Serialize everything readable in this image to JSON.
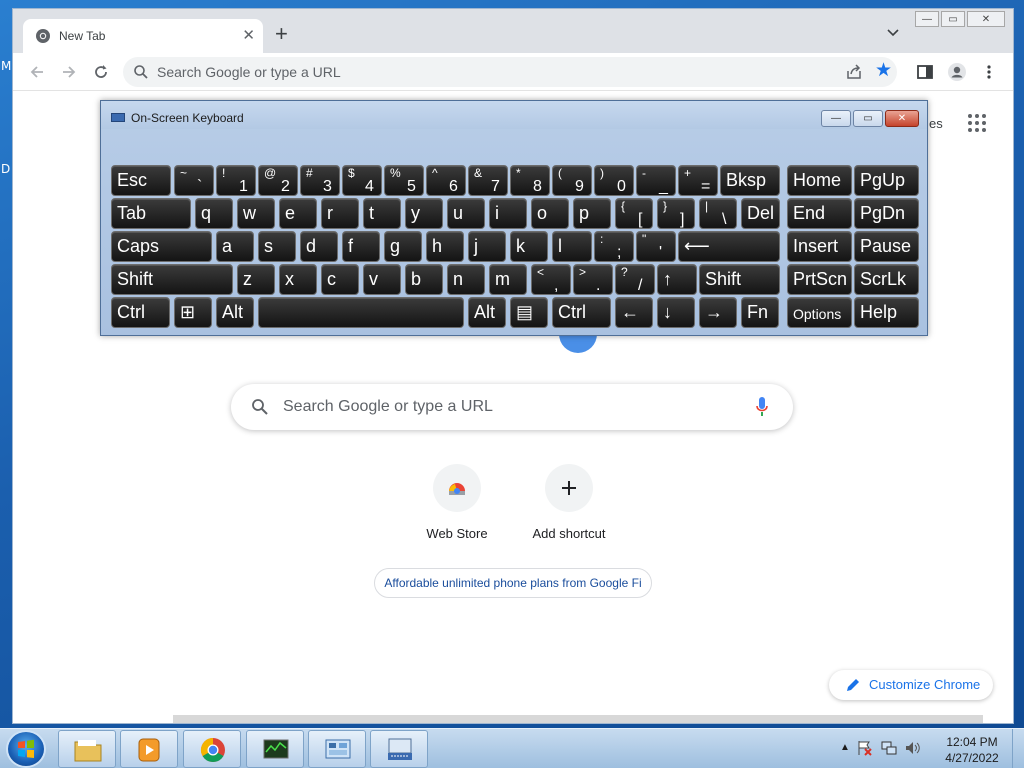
{
  "desktop": {
    "frag_a": "M",
    "frag_b": "D"
  },
  "browser": {
    "tab": {
      "title": "New Tab",
      "close": "✕"
    },
    "new_tab": "+",
    "omnibox": {
      "placeholder": "Search Google or type a URL"
    },
    "window_controls": {
      "minimize": "—",
      "maximize": "▭",
      "close": "✕"
    }
  },
  "ntp": {
    "apps_partial": "es",
    "search_placeholder": "Search Google or type a URL",
    "shortcuts": [
      {
        "label": "Web Store"
      },
      {
        "label": "Add shortcut"
      }
    ],
    "promo": "Affordable unlimited phone plans from Google Fi",
    "customize": "Customize Chrome"
  },
  "osk": {
    "title": "On-Screen Keyboard",
    "controls": {
      "minimize": "—",
      "restore": "▭",
      "close": "✕"
    },
    "rows": [
      [
        {
          "name": "esc",
          "label": "Esc"
        },
        {
          "name": "tilde",
          "shift": "~",
          "low": "`"
        },
        {
          "name": "1",
          "shift": "!",
          "low": "1"
        },
        {
          "name": "2",
          "shift": "@",
          "low": "2"
        },
        {
          "name": "3",
          "shift": "#",
          "low": "3"
        },
        {
          "name": "4",
          "shift": "$",
          "low": "4"
        },
        {
          "name": "5",
          "shift": "%",
          "low": "5"
        },
        {
          "name": "6",
          "shift": "^",
          "low": "6"
        },
        {
          "name": "7",
          "shift": "&",
          "low": "7"
        },
        {
          "name": "8",
          "shift": "*",
          "low": "8"
        },
        {
          "name": "9",
          "shift": "(",
          "low": "9"
        },
        {
          "name": "0",
          "shift": ")",
          "low": "0"
        },
        {
          "name": "minus",
          "shift": "-",
          "low": "_"
        },
        {
          "name": "equals",
          "shift": "+",
          "low": "="
        },
        {
          "name": "bksp",
          "label": "Bksp"
        },
        {
          "name": "home",
          "label": "Home"
        },
        {
          "name": "pgup",
          "label": "PgUp"
        }
      ],
      [
        {
          "name": "tab",
          "label": "Tab"
        },
        {
          "name": "q",
          "label": "q"
        },
        {
          "name": "w",
          "label": "w"
        },
        {
          "name": "e",
          "label": "e"
        },
        {
          "name": "r",
          "label": "r"
        },
        {
          "name": "t",
          "label": "t"
        },
        {
          "name": "y",
          "label": "y"
        },
        {
          "name": "u",
          "label": "u"
        },
        {
          "name": "i",
          "label": "i"
        },
        {
          "name": "o",
          "label": "o"
        },
        {
          "name": "p",
          "label": "p"
        },
        {
          "name": "lbracket",
          "shift": "{",
          "low": "["
        },
        {
          "name": "rbracket",
          "shift": "}",
          "low": "]"
        },
        {
          "name": "backslash",
          "shift": "|",
          "low": "\\"
        },
        {
          "name": "del",
          "label": "Del"
        },
        {
          "name": "end",
          "label": "End"
        },
        {
          "name": "pgdn",
          "label": "PgDn"
        }
      ],
      [
        {
          "name": "caps",
          "label": "Caps"
        },
        {
          "name": "a",
          "label": "a"
        },
        {
          "name": "s",
          "label": "s"
        },
        {
          "name": "d",
          "label": "d"
        },
        {
          "name": "f",
          "label": "f"
        },
        {
          "name": "g",
          "label": "g"
        },
        {
          "name": "h",
          "label": "h"
        },
        {
          "name": "j",
          "label": "j"
        },
        {
          "name": "k",
          "label": "k"
        },
        {
          "name": "l",
          "label": "l"
        },
        {
          "name": "semicolon",
          "shift": ":",
          "low": ";"
        },
        {
          "name": "quote",
          "shift": "\"",
          "low": "'"
        },
        {
          "name": "enter",
          "label": "⟵"
        },
        {
          "name": "insert",
          "label": "Insert"
        },
        {
          "name": "pause",
          "label": "Pause"
        }
      ],
      [
        {
          "name": "lshift",
          "label": "Shift"
        },
        {
          "name": "z",
          "label": "z"
        },
        {
          "name": "x",
          "label": "x"
        },
        {
          "name": "c",
          "label": "c"
        },
        {
          "name": "v",
          "label": "v"
        },
        {
          "name": "b",
          "label": "b"
        },
        {
          "name": "n",
          "label": "n"
        },
        {
          "name": "m",
          "label": "m"
        },
        {
          "name": "comma",
          "shift": "<",
          "low": ","
        },
        {
          "name": "period",
          "shift": ">",
          "low": "."
        },
        {
          "name": "slash",
          "shift": "?",
          "low": "/"
        },
        {
          "name": "up",
          "label": "↑"
        },
        {
          "name": "rshift",
          "label": "Shift"
        },
        {
          "name": "prtscn",
          "label": "PrtScn"
        },
        {
          "name": "scrlk",
          "label": "ScrLk"
        }
      ],
      [
        {
          "name": "lctrl",
          "label": "Ctrl"
        },
        {
          "name": "win",
          "label": "⊞"
        },
        {
          "name": "lalt",
          "label": "Alt"
        },
        {
          "name": "space",
          "label": ""
        },
        {
          "name": "ralt",
          "label": "Alt"
        },
        {
          "name": "menu",
          "label": "▤"
        },
        {
          "name": "rctrl",
          "label": "Ctrl"
        },
        {
          "name": "left",
          "label": "←"
        },
        {
          "name": "down",
          "label": "↓"
        },
        {
          "name": "right",
          "label": "→"
        },
        {
          "name": "fn",
          "label": "Fn"
        },
        {
          "name": "options",
          "label": "Options"
        },
        {
          "name": "help",
          "label": "Help"
        }
      ]
    ]
  },
  "taskbar": {
    "clock": {
      "time": "12:04 PM",
      "date": "4/27/2022"
    },
    "tray_arrow": "▲"
  }
}
